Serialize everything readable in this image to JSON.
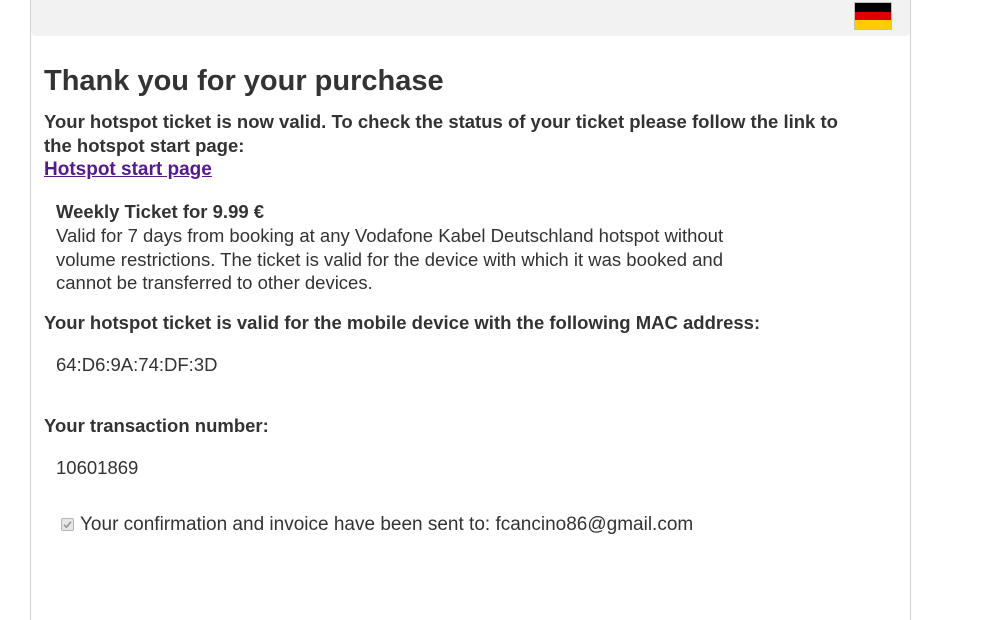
{
  "header": {
    "language_flag": {
      "icon": "germany-flag-icon",
      "colors": [
        "#000000",
        "#dd0000",
        "#ffcc00"
      ]
    }
  },
  "main": {
    "title": "Thank you for your purchase",
    "intro_line1": "Your hotspot ticket is now valid. To check the status of your ticket please follow the link to",
    "intro_line2": "the hotspot start page:",
    "start_link": "Hotspot start page",
    "ticket": {
      "title": "Weekly Ticket for 9.99 €",
      "desc_line1": "Valid for 7 days from booking at any Vodafone Kabel Deutschland hotspot without",
      "desc_line2": "volume restrictions. The ticket is valid for the device with which it was booked and",
      "desc_line3": "cannot be transferred to other devices."
    },
    "mac_label": "Your hotspot ticket is valid for the mobile device with the following MAC address:",
    "mac_value": "64:D6:9A:74:DF:3D",
    "transaction_label": "Your transaction number:",
    "transaction_value": "10601869",
    "confirmation": {
      "checked": true,
      "text": "Your confirmation and invoice have been sent to: fcancino86@gmail.com"
    }
  }
}
